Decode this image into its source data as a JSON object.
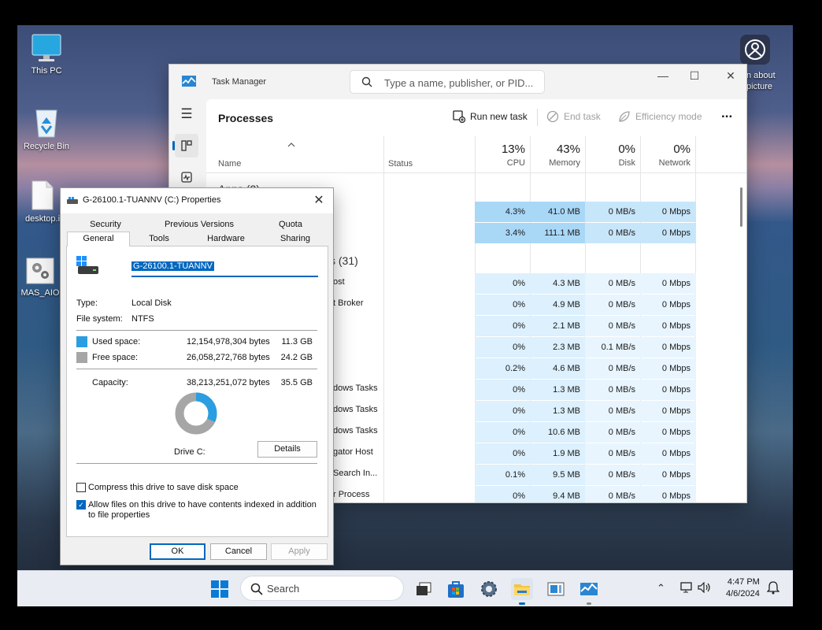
{
  "desktop": {
    "icons": [
      {
        "label": "This PC"
      },
      {
        "label": "Recycle Bin"
      },
      {
        "label": "desktop.i"
      },
      {
        "label": "MAS_AIO"
      }
    ],
    "spotlight_label": "n about\npicture"
  },
  "task_manager": {
    "title": "Task Manager",
    "search_placeholder": "Type a name, publisher, or PID...",
    "page_title": "Processes",
    "toolbar": {
      "run_new_task": "Run new task",
      "end_task": "End task",
      "efficiency_mode": "Efficiency mode",
      "more": "..."
    },
    "columns": {
      "name": "Name",
      "status": "Status",
      "cpu_pct": "13%",
      "cpu": "CPU",
      "memory_pct": "43%",
      "memory": "Memory",
      "disk_pct": "0%",
      "disk": "Disk",
      "network_pct": "0%",
      "network": "Network"
    },
    "group_apps": "Apps (2)",
    "group_background_suffix": "s (31)",
    "name_fragments": [
      "ost",
      "t Broker",
      "dows Tasks",
      "dows Tasks",
      "dows Tasks",
      "gator Host",
      "Search In...",
      "r Process"
    ],
    "rows": [
      {
        "cpu": "4.3%",
        "mem": "41.0 MB",
        "disk": "0 MB/s",
        "net": "0 Mbps"
      },
      {
        "cpu": "3.4%",
        "mem": "111.1 MB",
        "disk": "0 MB/s",
        "net": "0 Mbps"
      },
      {
        "cpu": "0%",
        "mem": "4.3 MB",
        "disk": "0 MB/s",
        "net": "0 Mbps"
      },
      {
        "cpu": "0%",
        "mem": "4.9 MB",
        "disk": "0 MB/s",
        "net": "0 Mbps"
      },
      {
        "cpu": "0%",
        "mem": "2.1 MB",
        "disk": "0 MB/s",
        "net": "0 Mbps"
      },
      {
        "cpu": "0%",
        "mem": "2.3 MB",
        "disk": "0.1 MB/s",
        "net": "0 Mbps"
      },
      {
        "cpu": "0.2%",
        "mem": "4.6 MB",
        "disk": "0 MB/s",
        "net": "0 Mbps"
      },
      {
        "cpu": "0%",
        "mem": "1.3 MB",
        "disk": "0 MB/s",
        "net": "0 Mbps"
      },
      {
        "cpu": "0%",
        "mem": "1.3 MB",
        "disk": "0 MB/s",
        "net": "0 Mbps"
      },
      {
        "cpu": "0%",
        "mem": "10.6 MB",
        "disk": "0 MB/s",
        "net": "0 Mbps"
      },
      {
        "cpu": "0%",
        "mem": "1.9 MB",
        "disk": "0 MB/s",
        "net": "0 Mbps"
      },
      {
        "cpu": "0.1%",
        "mem": "9.5 MB",
        "disk": "0 MB/s",
        "net": "0 Mbps"
      },
      {
        "cpu": "0%",
        "mem": "9.4 MB",
        "disk": "0 MB/s",
        "net": "0 Mbps"
      }
    ]
  },
  "properties": {
    "title": "G-26100.1-TUANNV (C:) Properties",
    "tabs_back": [
      "Security",
      "Previous Versions",
      "Quota"
    ],
    "tabs_front": [
      "General",
      "Tools",
      "Hardware",
      "Sharing"
    ],
    "volume_name": "G-26100.1-TUANNV",
    "type_label": "Type:",
    "type_value": "Local Disk",
    "fs_label": "File system:",
    "fs_value": "NTFS",
    "used_label": "Used space:",
    "used_bytes": "12,154,978,304 bytes",
    "used_gb": "11.3 GB",
    "free_label": "Free space:",
    "free_bytes": "26,058,272,768 bytes",
    "free_gb": "24.2 GB",
    "capacity_label": "Capacity:",
    "capacity_bytes": "38,213,251,072 bytes",
    "capacity_gb": "35.5 GB",
    "used_fraction": 0.318,
    "drive_label": "Drive C:",
    "details_button": "Details",
    "compress_label": "Compress this drive to save disk space",
    "compress_checked": false,
    "index_label": "Allow files on this drive to have contents indexed in addition to file properties",
    "index_checked": true,
    "ok": "OK",
    "cancel": "Cancel",
    "apply": "Apply",
    "colors": {
      "used": "#2a9ee0",
      "free": "#a6a6a6"
    }
  },
  "taskbar": {
    "search_placeholder": "Search",
    "time": "4:47 PM",
    "date": "4/6/2024"
  }
}
